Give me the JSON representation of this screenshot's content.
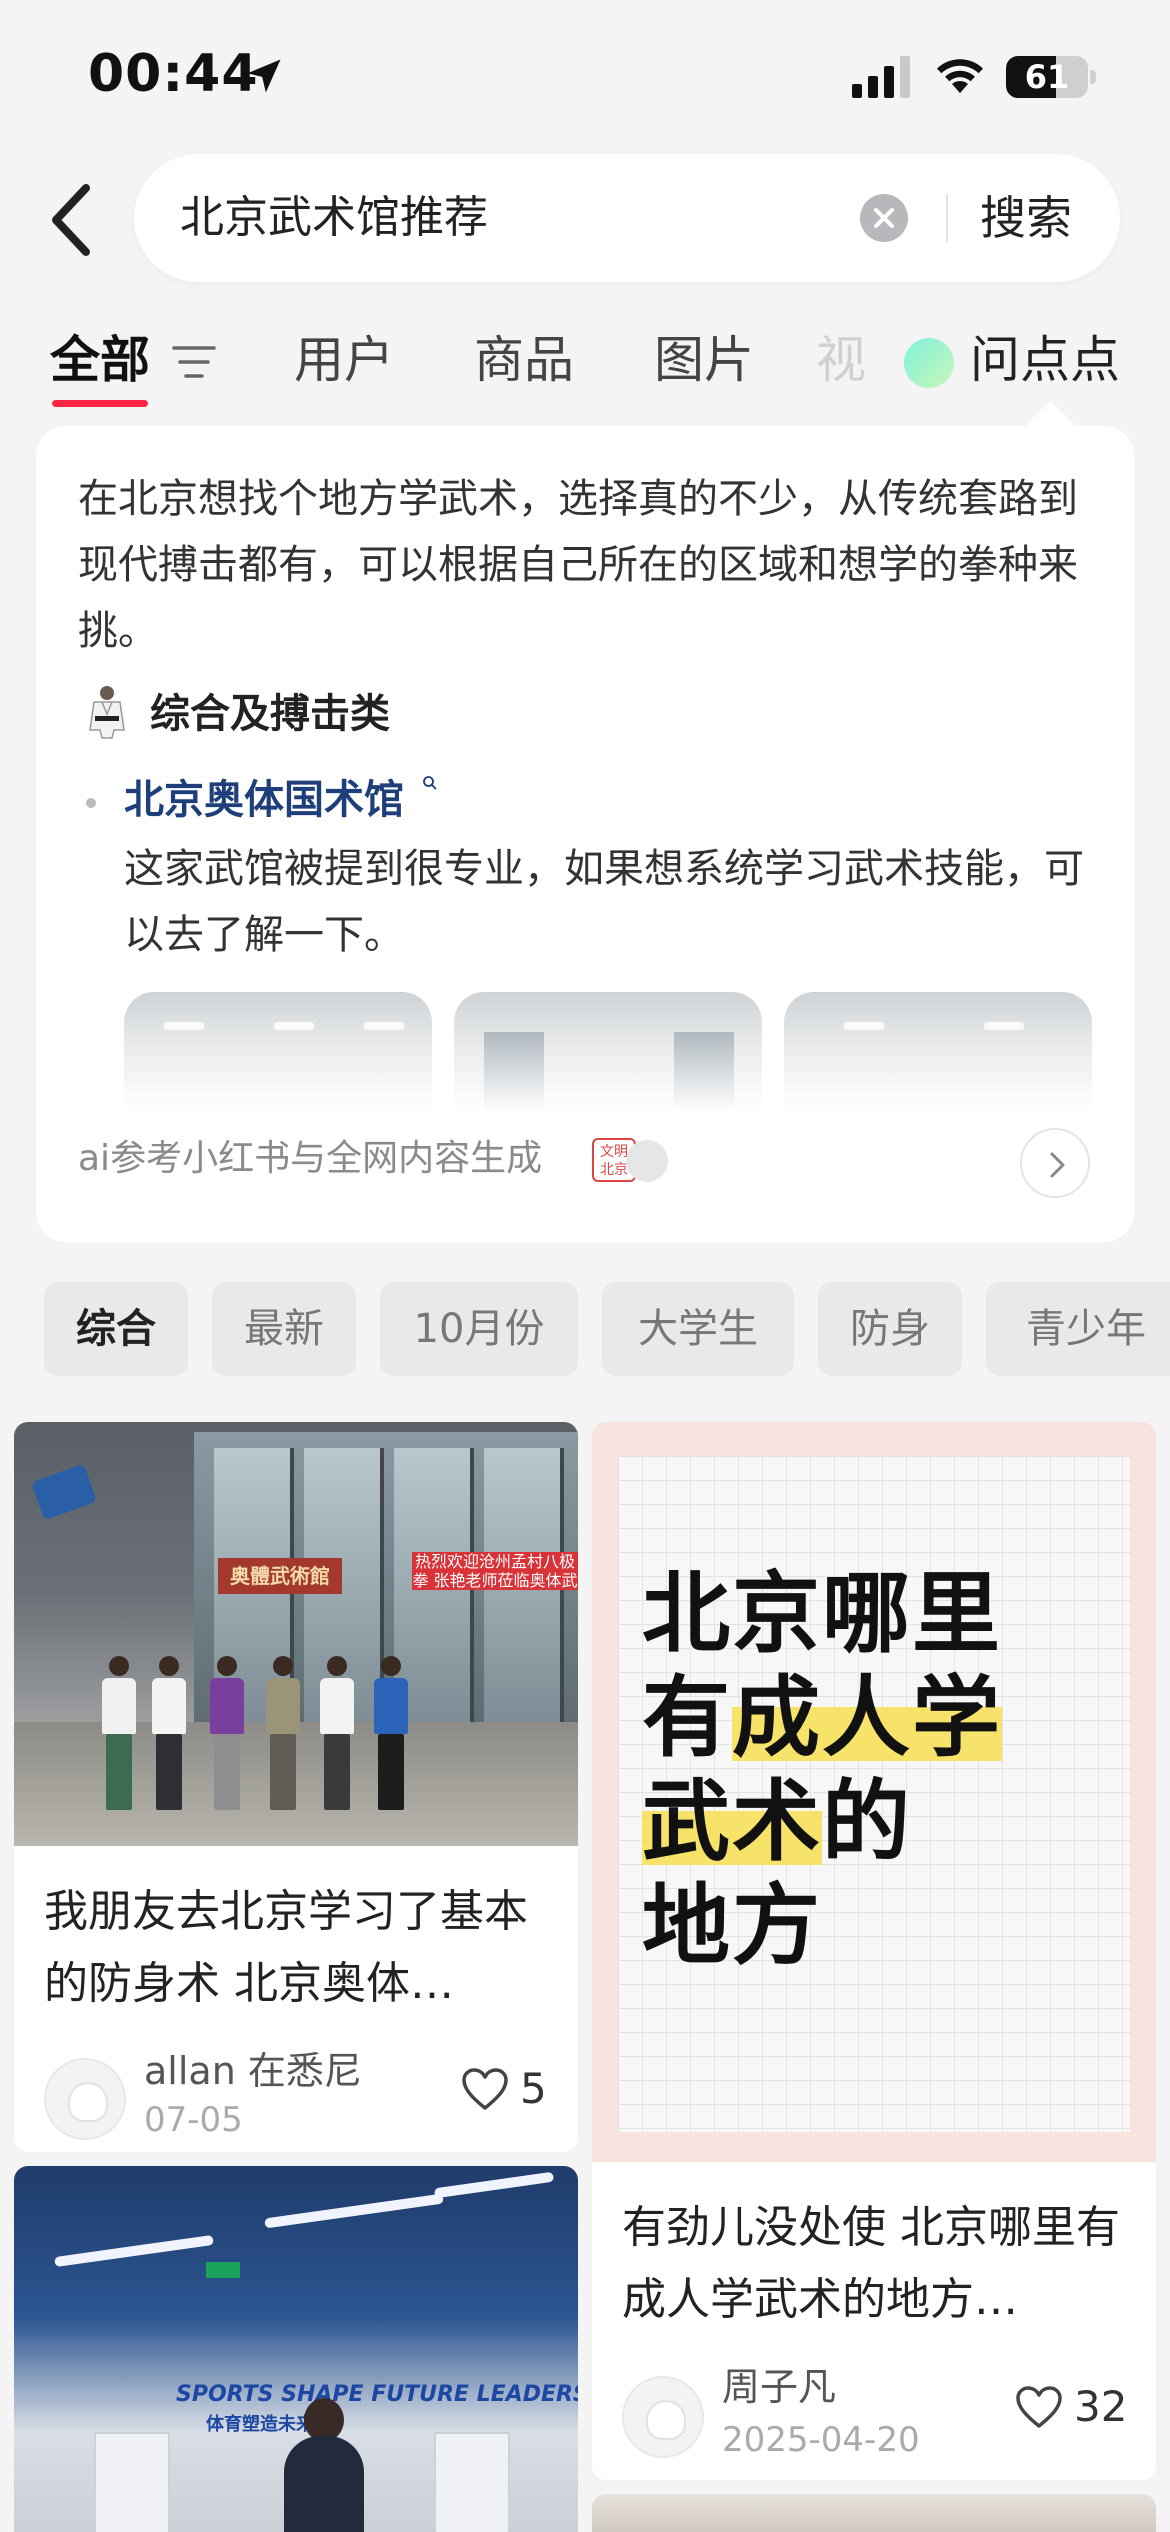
{
  "status_bar": {
    "time": "00:44",
    "battery": "61",
    "battery_level": 0.61
  },
  "search": {
    "query": "北京武术馆推荐",
    "button": "搜索"
  },
  "tabs": [
    {
      "label": "全部",
      "active": true
    },
    {
      "label": "用户"
    },
    {
      "label": "商品"
    },
    {
      "label": "图片"
    },
    {
      "label": "视"
    }
  ],
  "ask": {
    "label": "问点点"
  },
  "ai_answer": {
    "intro": "在北京想找个地方学武术，选择真的不少，从传统套路到现代搏击都有，可以根据自己所在的区域和想学的拳种来挑。",
    "section_title": "综合及搏击类",
    "place_name": "北京奥体国术馆",
    "place_desc": "这家武馆被提到很专业，如果想系统学习武术技能，可以去了解一下。",
    "footer": "ai参考小红书与全网内容生成",
    "seal_text": "文明北京"
  },
  "filter_chips": [
    "综合",
    "最新",
    "10月份",
    "大学生",
    "防身",
    "青少年"
  ],
  "posts": [
    {
      "title": "我朋友去北京学习了基本的防身术 北京奥体…",
      "author": "allan 在悉尼",
      "date": "07-05",
      "likes": "5",
      "image": {
        "sign": "奥體武術館",
        "banner": "热烈欢迎沧州孟村八极拳 张艳老师莅临奥体武"
      }
    },
    {
      "title": "有劲儿没处使 北京哪里有成人学武术的地方…",
      "author": "周子凡",
      "date": "2025-04-20",
      "likes": "32",
      "poster": {
        "line1": "北京哪里",
        "line2a": "有",
        "line2b": "成人学",
        "line3a": "武术",
        "line3b": "的",
        "line4": "地方"
      }
    },
    {
      "image": {
        "slogan": "SPORTS SHAPE FUTURE LEADERS!",
        "slogan_sub": "体育塑造未来"
      }
    }
  ],
  "colors": {
    "accent": "#ff2442",
    "link": "#1f3f7a",
    "highlight": "#f7e36a"
  }
}
